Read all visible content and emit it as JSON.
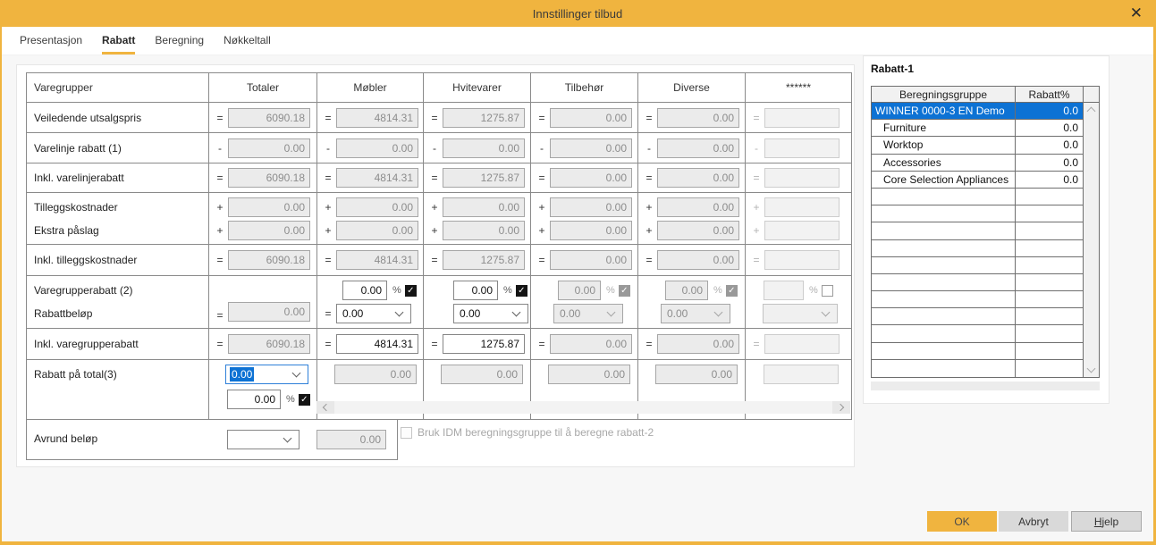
{
  "window": {
    "title": "Innstillinger tilbud",
    "close_glyph": "✕"
  },
  "tabs": [
    {
      "label": "Presentasjon",
      "active": false
    },
    {
      "label": "Rabatt",
      "active": true
    },
    {
      "label": "Beregning",
      "active": false
    },
    {
      "label": "Nøkkeltall",
      "active": false
    }
  ],
  "matrix": {
    "header": [
      "Varegrupper",
      "Totaler",
      "Møbler",
      "Hvitevarer",
      "Tilbehør",
      "Diverse",
      "******"
    ],
    "rows": [
      {
        "type": "simple",
        "label": "Veiledende utsalgspris",
        "op": "=",
        "cells": [
          {
            "v": "6090.18",
            "s": "ro"
          },
          {
            "v": "4814.31",
            "s": "ro"
          },
          {
            "v": "1275.87",
            "s": "ro"
          },
          {
            "v": "0.00",
            "s": "ro"
          },
          {
            "v": "0.00",
            "s": "ro"
          },
          {
            "v": "",
            "s": "dis"
          }
        ]
      },
      {
        "type": "simple",
        "label": "Varelinje rabatt (1)",
        "op": "-",
        "cells": [
          {
            "v": "0.00",
            "s": "ro"
          },
          {
            "v": "0.00",
            "s": "ro"
          },
          {
            "v": "0.00",
            "s": "ro"
          },
          {
            "v": "0.00",
            "s": "ro"
          },
          {
            "v": "0.00",
            "s": "ro"
          },
          {
            "v": "",
            "s": "dis"
          }
        ]
      },
      {
        "type": "simple",
        "label": "Inkl. varelinjerabatt",
        "op": "=",
        "cells": [
          {
            "v": "6090.18",
            "s": "ro"
          },
          {
            "v": "4814.31",
            "s": "ro"
          },
          {
            "v": "1275.87",
            "s": "ro"
          },
          {
            "v": "0.00",
            "s": "ro"
          },
          {
            "v": "0.00",
            "s": "ro"
          },
          {
            "v": "",
            "s": "dis"
          }
        ]
      },
      {
        "type": "double",
        "labels": [
          "Tilleggskostnader",
          "Ekstra påslag"
        ],
        "op": "+",
        "cells": [
          {
            "v1": "0.00",
            "v2": "0.00",
            "s": "ro"
          },
          {
            "v1": "0.00",
            "v2": "0.00",
            "s": "ro"
          },
          {
            "v1": "0.00",
            "v2": "0.00",
            "s": "ro"
          },
          {
            "v1": "0.00",
            "v2": "0.00",
            "s": "ro"
          },
          {
            "v1": "0.00",
            "v2": "0.00",
            "s": "ro"
          },
          {
            "v1": "",
            "v2": "",
            "s": "dis"
          }
        ]
      },
      {
        "type": "simple",
        "label": "Inkl. tilleggskostnader",
        "op": "=",
        "cells": [
          {
            "v": "6090.18",
            "s": "ro"
          },
          {
            "v": "4814.31",
            "s": "ro"
          },
          {
            "v": "1275.87",
            "s": "ro"
          },
          {
            "v": "0.00",
            "s": "ro"
          },
          {
            "v": "0.00",
            "s": "ro"
          },
          {
            "v": "",
            "s": "dis"
          }
        ]
      },
      {
        "type": "group",
        "labels": [
          "Varegrupperabatt (2)",
          "Rabattbeløp"
        ],
        "total": {
          "op": "=",
          "v": "0.00",
          "s": "ro"
        },
        "cells": [
          {
            "pct": "0.00",
            "pct_s": "ed",
            "chk": true,
            "chk_s": "ed",
            "op": "=",
            "sel": "0.00",
            "sel_s": "ed"
          },
          {
            "pct": "0.00",
            "pct_s": "ed",
            "chk": true,
            "chk_s": "ed",
            "op": "",
            "sel": "0.00",
            "sel_s": "ed"
          },
          {
            "pct": "0.00",
            "pct_s": "ro",
            "chk": true,
            "chk_s": "dis",
            "op": "",
            "sel": "0.00",
            "sel_s": "ro"
          },
          {
            "pct": "0.00",
            "pct_s": "ro",
            "chk": true,
            "chk_s": "dis",
            "op": "",
            "sel": "0.00",
            "sel_s": "ro"
          },
          {
            "pct": "",
            "pct_s": "dis",
            "chk": false,
            "chk_s": "dis",
            "op": "",
            "sel": "",
            "sel_s": "dis"
          }
        ]
      },
      {
        "type": "simple",
        "label": "Inkl. varegrupperabatt",
        "op": "=",
        "cells": [
          {
            "v": "6090.18",
            "s": "ro"
          },
          {
            "v": "4814.31",
            "s": "ed"
          },
          {
            "v": "1275.87",
            "s": "ed"
          },
          {
            "v": "0.00",
            "s": "ro"
          },
          {
            "v": "0.00",
            "s": "ro"
          },
          {
            "v": "",
            "s": "dis"
          }
        ]
      },
      {
        "type": "totaldisc",
        "label": "Rabatt på total(3)",
        "select": {
          "v": "0.00",
          "focused": true
        },
        "pct": {
          "v": "0.00",
          "chk": true
        },
        "cells": [
          {
            "v": "0.00",
            "s": "ro"
          },
          {
            "v": "0.00",
            "s": "ro"
          },
          {
            "v": "0.00",
            "s": "ro"
          },
          {
            "v": "0.00",
            "s": "ro"
          },
          {
            "v": "",
            "s": "dis"
          }
        ]
      }
    ]
  },
  "avrund": {
    "label": "Avrund beløp",
    "select_value": "",
    "amount": "0.00"
  },
  "idm": {
    "label": "Bruk IDM beregningsgruppe til å beregne rabatt-2",
    "checked": false,
    "enabled": false
  },
  "rabatt1": {
    "title": "Rabatt-1",
    "columns": [
      "Beregningsgruppe",
      "Rabatt%"
    ],
    "rows": [
      {
        "name": "WINNER 0000-3 EN Demo",
        "value": "0.0",
        "selected": true,
        "indent": false
      },
      {
        "name": "Furniture",
        "value": "0.0",
        "selected": false,
        "indent": true
      },
      {
        "name": "Worktop",
        "value": "0.0",
        "selected": false,
        "indent": true
      },
      {
        "name": "Accessories",
        "value": "0.0",
        "selected": false,
        "indent": true
      },
      {
        "name": "Core Selection Appliances",
        "value": "0.0",
        "selected": false,
        "indent": true
      }
    ],
    "empty_rows": 11,
    "total_rows": 16
  },
  "footer": {
    "ok": "OK",
    "cancel": "Avbryt",
    "help": "Hjelp"
  },
  "colors": {
    "accent": "#F0B43F",
    "selection": "#0D72D4",
    "focus_border": "#2E80D9"
  }
}
